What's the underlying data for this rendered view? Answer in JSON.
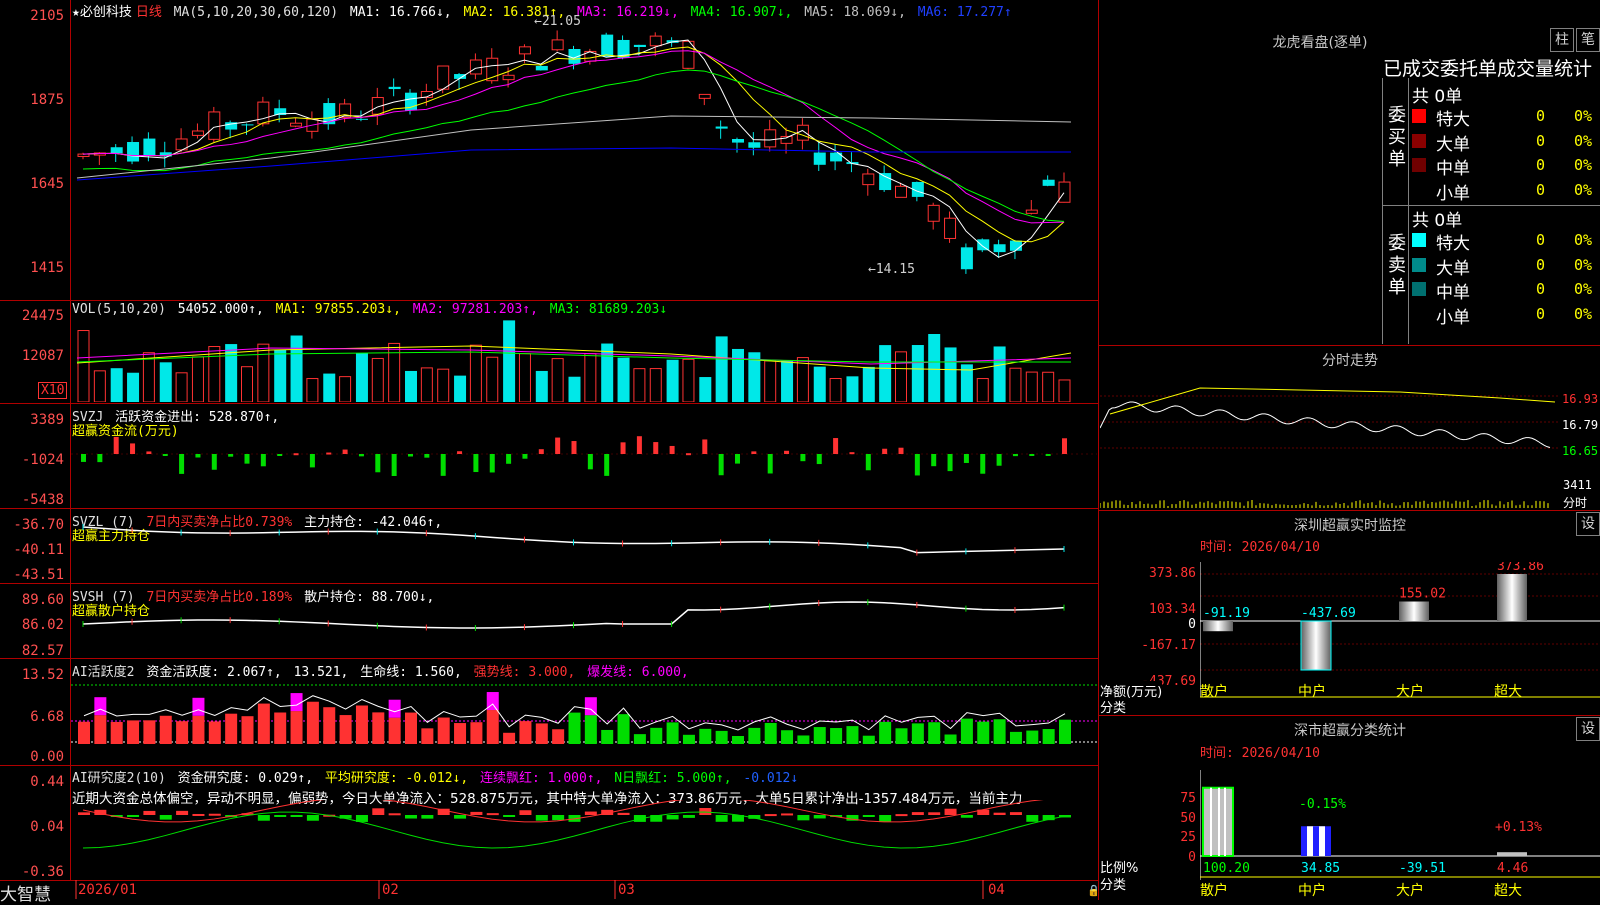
{
  "colors": {
    "up": "#ff3232",
    "down": "#00e8e8",
    "ma1": "#ffffff",
    "ma2": "#ffff00",
    "ma3": "#ff00ff",
    "ma4": "#00ff00",
    "ma5": "#c0c0c0",
    "ma6": "#0000ff",
    "axis": "#ff3232",
    "green": "#00dd00",
    "magenta": "#ff00ff"
  },
  "main": {
    "name_star": "★必创科技",
    "period": "日线",
    "ma_params": "MA(5,10,20,30,60,120)",
    "ma1": "MA1: 16.766↓,",
    "ma2": "MA2: 16.381↑,",
    "ma3": "MA3: 16.219↓,",
    "ma4": "MA4: 16.907↓,",
    "ma5": "MA5: 18.069↓,",
    "ma6": "MA6: 17.277↑",
    "high_label": "←21.05",
    "low_label": "←14.15",
    "yticks": [
      "2105",
      "1875",
      "1645",
      "1415"
    ]
  },
  "vol": {
    "title": "VOL(5,10,20)",
    "value": "54052.000↑,",
    "ma1": "MA1: 97855.203↓,",
    "ma2": "MA2: 97281.203↑,",
    "ma3": "MA3: 81689.203↓",
    "yticks": [
      "24475",
      "12087"
    ],
    "unit": "X10"
  },
  "svzj": {
    "title": "SVZJ",
    "text": "活跃资金进出: 528.870↑,",
    "sub": "超赢资金流(万元)",
    "yticks": [
      "3389",
      "-1024",
      "-5438"
    ]
  },
  "svzl": {
    "title": "SVZL (7)",
    "text1": "7日内买卖净占比0.739%",
    "text2": "主力持仓: -42.046↑,",
    "sub": "超赢主力持仓",
    "yticks": [
      "-36.70",
      "-40.11",
      "-43.51"
    ]
  },
  "svsh": {
    "title": "SVSH (7)",
    "text1": "7日内买卖净占比0.189%",
    "text2": "散户持仓: 88.700↓,",
    "sub": "超赢散户持仓",
    "yticks": [
      "89.60",
      "86.02",
      "82.57"
    ]
  },
  "ai1": {
    "title": "AI活跃度2",
    "text1": "资金活跃度: 2.067↑,",
    "text2": "13.521,",
    "text3": "生命线: 1.560,",
    "text4": "强势线: 3.000,",
    "text5": "爆发线: 6.000,",
    "yticks": [
      "13.52",
      "6.68",
      "0.00"
    ]
  },
  "ai2": {
    "title": "AI研究度2(10)",
    "text1": "资金研究度: 0.029↑,",
    "text2": "平均研究度: -0.012↓,",
    "text3": "连续飘红: 1.000↑,",
    "text4": "N日飘红: 5.000↑,",
    "text5": "-0.012↓",
    "desc": "近期大资金总体偏空，异动不明显，偏弱势，今日大单净流入：528.875万元，其中特大单净流入：373.86万元，大单5日累计净出-1357.484万元，当前主力",
    "yticks": [
      "0.44",
      "0.04",
      "-0.36"
    ]
  },
  "xaxis": {
    "labels": [
      "2026/01",
      "02",
      "03",
      "04"
    ]
  },
  "brand": "大智慧",
  "longhu": {
    "title": "龙虎看盘(逐单)",
    "btn_zhu": "柱",
    "btn_bi": "笔",
    "header": "已成交委托单成交量统计",
    "buy_total": "共 0单",
    "buy_label": "委买单",
    "buy_rows": [
      {
        "name": "特大",
        "val": "0",
        "pct": "0%",
        "color": "#ff0000"
      },
      {
        "name": "大单",
        "val": "0",
        "pct": "0%",
        "color": "#8b0000"
      },
      {
        "name": "中单",
        "val": "0",
        "pct": "0%",
        "color": "#700000"
      },
      {
        "name": "小单",
        "val": "0",
        "pct": "0%",
        "color": "#000000"
      }
    ],
    "sell_total": "共 0单",
    "sell_label": "委卖单",
    "sell_rows": [
      {
        "name": "特大",
        "val": "0",
        "pct": "0%",
        "color": "#00ffff"
      },
      {
        "name": "大单",
        "val": "0",
        "pct": "0%",
        "color": "#008b8b"
      },
      {
        "name": "中单",
        "val": "0",
        "pct": "0%",
        "color": "#007070"
      },
      {
        "name": "小单",
        "val": "0",
        "pct": "0%",
        "color": "#000000"
      }
    ]
  },
  "intraday": {
    "title": "分时走势",
    "prices": [
      "16.93",
      "16.79",
      "16.65"
    ],
    "vol_label": "3411",
    "vol_unit": "分时"
  },
  "monitor": {
    "title": "深圳超赢实时监控",
    "btn": "设",
    "time": "时间: 2026/04/10",
    "yticks": [
      "373.86",
      "103.34",
      "0",
      "-167.17",
      "-437.69"
    ],
    "ylabel": "净额(万元)",
    "xlabel": "分类",
    "cats": [
      "散户",
      "中户",
      "大户",
      "超大"
    ],
    "values": [
      -91.19,
      -437.69,
      155.02,
      373.86
    ],
    "value_labels": [
      "-91.19",
      "-437.69",
      "155.02",
      "373.86"
    ]
  },
  "stats": {
    "title": "深市超赢分类统计",
    "btn": "设",
    "time": "时间: 2026/04/10",
    "yticks": [
      "75",
      "50",
      "25",
      "0"
    ],
    "ylabel": "比例%",
    "xlabel": "分类",
    "cats": [
      "散户",
      "中户",
      "大户",
      "超大"
    ],
    "top_labels": [
      "",
      "-0.15%",
      "",
      "+0.13%"
    ],
    "values": [
      100.2,
      34.85,
      -39.51,
      4.46
    ],
    "bottom_labels": [
      "100.20",
      "34.85",
      "-39.51",
      "4.46"
    ]
  }
}
